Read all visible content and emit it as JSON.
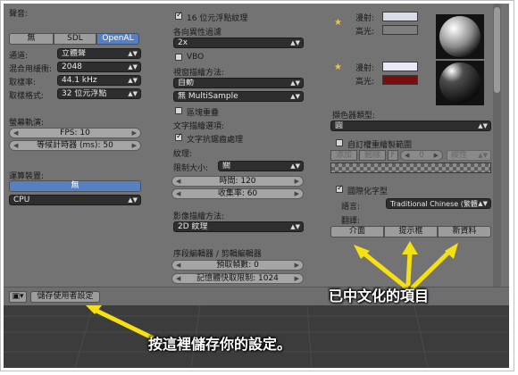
{
  "left": {
    "sound": {
      "label": "聲音:",
      "tabs": [
        "無",
        "SDL",
        "OpenAL"
      ],
      "active_tab": "OpenAL"
    },
    "channels": {
      "label": "通道:",
      "value": "立體聲"
    },
    "mix_buffer": {
      "label": "混合用緩衝:",
      "value": "2048"
    },
    "sample_rate": {
      "label": "取樣率:",
      "value": "44.1 kHz"
    },
    "sample_format": {
      "label": "取樣格式:",
      "value": "32 位元浮點"
    },
    "screencast": {
      "label": "螢幕軌演:",
      "fps": "FPS: 10",
      "wait_timer": "等候計時器 (ms): 50"
    },
    "compute": {
      "label": "運算裝置:",
      "none_button": "無",
      "device": "CPU"
    }
  },
  "middle": {
    "float_textures": {
      "label": "16 位元浮點紋理",
      "checked": true
    },
    "anisotropic": {
      "label": "各向異性過濾",
      "value": "2x"
    },
    "vbo": {
      "label": "VBO",
      "checked": false
    },
    "window_draw": {
      "label": "視窗描繪方法:",
      "value": "自動"
    },
    "multisample": {
      "value": "無 MultiSample"
    },
    "region_overlap": {
      "label": "區塊重疊",
      "checked": false
    },
    "text_aa_title": "文字描繪選項:",
    "text_aa": {
      "label": "文字抗鋸齒處理",
      "checked": true
    },
    "textures_title": "紋理:",
    "limit_size": {
      "label": "限制大小:",
      "value": "關"
    },
    "time": "時間: 120",
    "collection_rate": "收集率: 60",
    "image_draw": {
      "label": "影像描繪方法:",
      "value": "2D 紋理"
    },
    "sequencer_title": "序段編輯器 / 剪輯編輯器",
    "prefetch": "預取幀數: 0",
    "memory_cache": "記憶體快取限制: 1024"
  },
  "right": {
    "diffuse_label": "漫射:",
    "specular_label": "高光:",
    "light1": {
      "diffuse_color": "#d9dbe6",
      "specular_color": "#7f7f7f"
    },
    "light2": {
      "diffuse_color": "#e8e9f4",
      "specular_color": "#7a0e0e"
    },
    "color_picker": {
      "label": "擷色器類型:",
      "value": "圓"
    },
    "custom_weight": {
      "label": "自訂權重繪製範圍",
      "checked": false
    },
    "weight_buttons": [
      "添加",
      "刪除",
      "F",
      "0",
      "縱性"
    ],
    "i18n": {
      "label": "國際化字型",
      "checked": true
    },
    "language": {
      "label": "語言:",
      "value": "Traditional Chinese (繁體中"
    },
    "translate_label": "翻譯:",
    "translate_buttons": [
      "介面",
      "提示框",
      "新資料"
    ]
  },
  "bottom": {
    "save_button": "儲存使用者設定"
  },
  "annotations": {
    "localized_items": "已中文化的項目",
    "save_hint": "按這裡儲存你的設定。"
  },
  "colors": {
    "accent_blue": "#5680c2",
    "arrow_yellow": "#f5e012"
  }
}
